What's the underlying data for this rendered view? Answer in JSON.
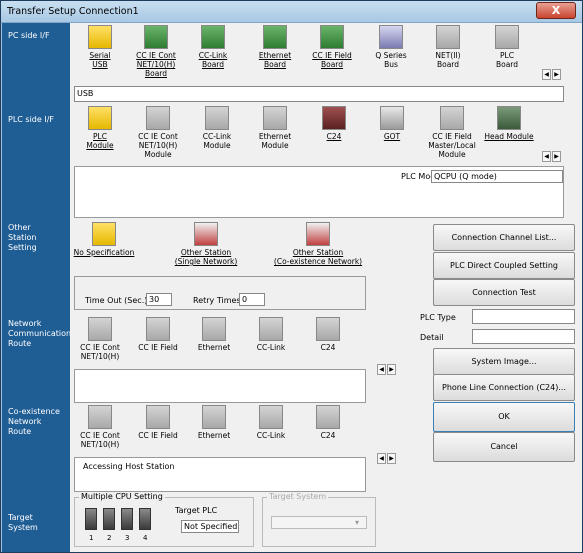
{
  "window": {
    "title": "Transfer Setup Connection1",
    "close": "X"
  },
  "side_labels": {
    "pc_side": "PC side I/F",
    "plc_side": "PLC side I/F",
    "other_station": "Other\nStation\nSetting",
    "network_route": "Network\nCommunication\nRoute",
    "coexistence_route": "Co-existence\nNetwork\nRoute",
    "target_system": "Target\nSystem"
  },
  "pc_side": {
    "options": [
      {
        "line1": "Serial",
        "line2": "USB",
        "line3": ""
      },
      {
        "line1": "CC IE Cont",
        "line2": "NET/10(H)",
        "line3": "Board"
      },
      {
        "line1": "CC-Link",
        "line2": "Board",
        "line3": ""
      },
      {
        "line1": "Ethernet",
        "line2": "Board",
        "line3": ""
      },
      {
        "line1": "CC IE Field",
        "line2": "Board",
        "line3": ""
      },
      {
        "line1": "Q Series",
        "line2": "Bus",
        "line3": ""
      },
      {
        "line1": "NET(II)",
        "line2": "Board",
        "line3": ""
      },
      {
        "line1": "PLC",
        "line2": "Board",
        "line3": ""
      }
    ],
    "detail": "USB"
  },
  "plc_side": {
    "options": [
      {
        "line1": "PLC",
        "line2": "Module",
        "line3": ""
      },
      {
        "line1": "CC IE Cont",
        "line2": "NET/10(H)",
        "line3": "Module"
      },
      {
        "line1": "CC-Link",
        "line2": "Module",
        "line3": ""
      },
      {
        "line1": "Ethernet",
        "line2": "Module",
        "line3": ""
      },
      {
        "line1": "C24",
        "line2": "",
        "line3": ""
      },
      {
        "line1": "GOT",
        "line2": "",
        "line3": ""
      },
      {
        "line1": "CC IE Field",
        "line2": "Master/Local",
        "line3": "Module"
      },
      {
        "line1": "Head Module",
        "line2": "",
        "line3": ""
      }
    ],
    "plc_mode_label": "PLC Mode",
    "plc_mode_value": "QCPU (Q mode)"
  },
  "other_station": {
    "options": [
      {
        "line1": "No Specification",
        "line2": ""
      },
      {
        "line1": "Other Station",
        "line2": "(Single Network)"
      },
      {
        "line1": "Other Station",
        "line2": "(Co-existence Network)"
      }
    ],
    "timeout_label": "Time Out (Sec.)",
    "timeout_value": "30",
    "retry_label": "Retry Times",
    "retry_value": "0"
  },
  "network_route": {
    "options": [
      {
        "line1": "CC IE Cont",
        "line2": "NET/10(H)"
      },
      {
        "line1": "CC IE Field",
        "line2": ""
      },
      {
        "line1": "Ethernet",
        "line2": ""
      },
      {
        "line1": "CC-Link",
        "line2": ""
      },
      {
        "line1": "C24",
        "line2": ""
      }
    ]
  },
  "coexistence_route": {
    "options": [
      {
        "line1": "CC IE Cont",
        "line2": "NET/10(H)"
      },
      {
        "line1": "CC IE Field",
        "line2": ""
      },
      {
        "line1": "Ethernet",
        "line2": ""
      },
      {
        "line1": "CC-Link",
        "line2": ""
      },
      {
        "line1": "C24",
        "line2": ""
      }
    ],
    "detail": "Accessing Host Station"
  },
  "target_system": {
    "multiple_cpu_label": "Multiple CPU Setting",
    "cpu_numbers": [
      "1",
      "2",
      "3",
      "4"
    ],
    "target_plc_label": "Target PLC",
    "target_plc_value": "Not Specified",
    "target_system_label": "Target System"
  },
  "buttons": {
    "connection_channel_list": "Connection Channel List...",
    "plc_direct": "PLC Direct Coupled Setting",
    "connection_test": "Connection Test",
    "system_image": "System Image...",
    "phone_line": "Phone Line Connection (C24)...",
    "ok": "OK",
    "cancel": "Cancel"
  },
  "plc_info": {
    "plc_type_label": "PLC Type",
    "detail_label": "Detail",
    "plc_type_value": "",
    "detail_value": ""
  },
  "colors": {
    "sidebar": "#1f5d95",
    "panel": "#f0f0f0",
    "titlebar": "#a7c8e4"
  }
}
